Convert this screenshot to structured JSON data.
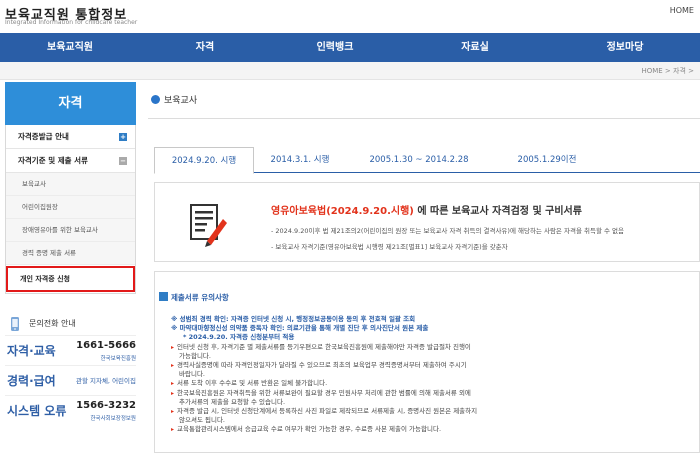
{
  "header": {
    "logo_title": "보육교직원 통합정보",
    "logo_sub": "Integrated Information for childcare teacher",
    "home": "HOME"
  },
  "gnb": [
    "보육교직원",
    "자격",
    "인력뱅크",
    "자료실",
    "정보마당"
  ],
  "location": "HOME  >  자격  >",
  "sidebar": {
    "title": "자격",
    "items": [
      {
        "label": "자격증발급 안내",
        "toggle": "+"
      },
      {
        "label": "자격기준 및 제출 서류",
        "toggle": "−"
      }
    ],
    "subitems": [
      "보육교사",
      "어린이집원장",
      "장애영유아를 위한 보육교사",
      "경력 증명 제출 서류",
      "개인 자격증 신청"
    ]
  },
  "contact": {
    "title": "문의전화 안내",
    "rows": [
      {
        "label": "자격·교육",
        "number": "1661-5666",
        "org": "한국보육진흥원"
      },
      {
        "label": "경력·급여",
        "number": "",
        "org": "관할 지자체, 어린이집"
      },
      {
        "label": "시스템 오류",
        "number": "1566-3232",
        "org": "한국사회보장정보원"
      }
    ]
  },
  "main": {
    "title": "보육교사",
    "tabs": [
      "2024.9.20. 시행",
      "2014.3.1. 시행",
      "2005.1.30 ~ 2014.2.28",
      "2005.1.29이전"
    ],
    "intro": {
      "head_red": "영유아보육법(2024.9.20.시행)",
      "head_dark": " 에 따른 보육교사 자격검정 및 구비서류",
      "line1": "- 2024.9.20이후 법 제21조의2(어린이집의 원장 또는 보육교사 자격 취득의 결격사유)에 해당하는 사람은 자격을 취득할 수 없음",
      "line2": "- 보육교사 자격기준(영유아보육법 시행령 제21조[별표1] 보육교사 자격기준)을 갖춘자"
    },
    "notice": {
      "title": "제출서류 유의사항",
      "lines": [
        {
          "text": "※ 성범죄 경력 확인: 자격증 인터넷 신청 시, 행정정보공동이용 동의 후 전호적 일괄 조회",
          "style": "blue"
        },
        {
          "text": "※ 마약대마향정신성 의약품 중독자 확인: 의료기관을 통해 개별 진단 후 의사진단서 원본 제출",
          "style": "blue"
        },
        {
          "text": "* 2024.9.20. 자격증 신청분부터 적용",
          "style": "blue-sub"
        },
        {
          "text": "인터넷 신청 후, 자격기준 별 제출서류를 등기우편으로 한국보육진흥원에 제출해야만 자격증 발급절차 진행이",
          "style": "bullet"
        },
        {
          "text": "가능합니다.",
          "style": "plain"
        },
        {
          "text": "경력사실증명에 따라 자격인정일자가 달라질 수 있으므로 최초의 보육업무 경력증명서부터 제출하여 주시기",
          "style": "bullet"
        },
        {
          "text": "바랍니다.",
          "style": "plain"
        },
        {
          "text": "서류 도착 이후 수수료 및 서류 반환은 일체 불가합니다.",
          "style": "bullet"
        },
        {
          "text": "한국보육진흥원은 자격취득을 위한 서류보완이 필요할 경우 민원사무 처리에 관한 범률에 의해 제출서류 외에",
          "style": "bullet"
        },
        {
          "text": "추가서류의 제출을 요청할 수 있습니다.",
          "style": "plain"
        },
        {
          "text": "자격증 발급 시, 인터넷 신청단계에서 등록하신 사진 파일로 제작되므로 서류제출 시, 증명사진 원본은 제출하지",
          "style": "bullet"
        },
        {
          "text": "않으셔도 됩니다.",
          "style": "plain"
        },
        {
          "text": "교육통합관리시스템에서 승급교육 수료 여부가 확인 가능한 경우, 수료증 사본 제출이 가능합니다.",
          "style": "bullet"
        }
      ]
    }
  },
  "colors": {
    "brand_blue": "#2a5ea7",
    "side_blue": "#2e8ed9",
    "accent_red": "#e2331c",
    "highlight_red": "#e21a1a"
  }
}
